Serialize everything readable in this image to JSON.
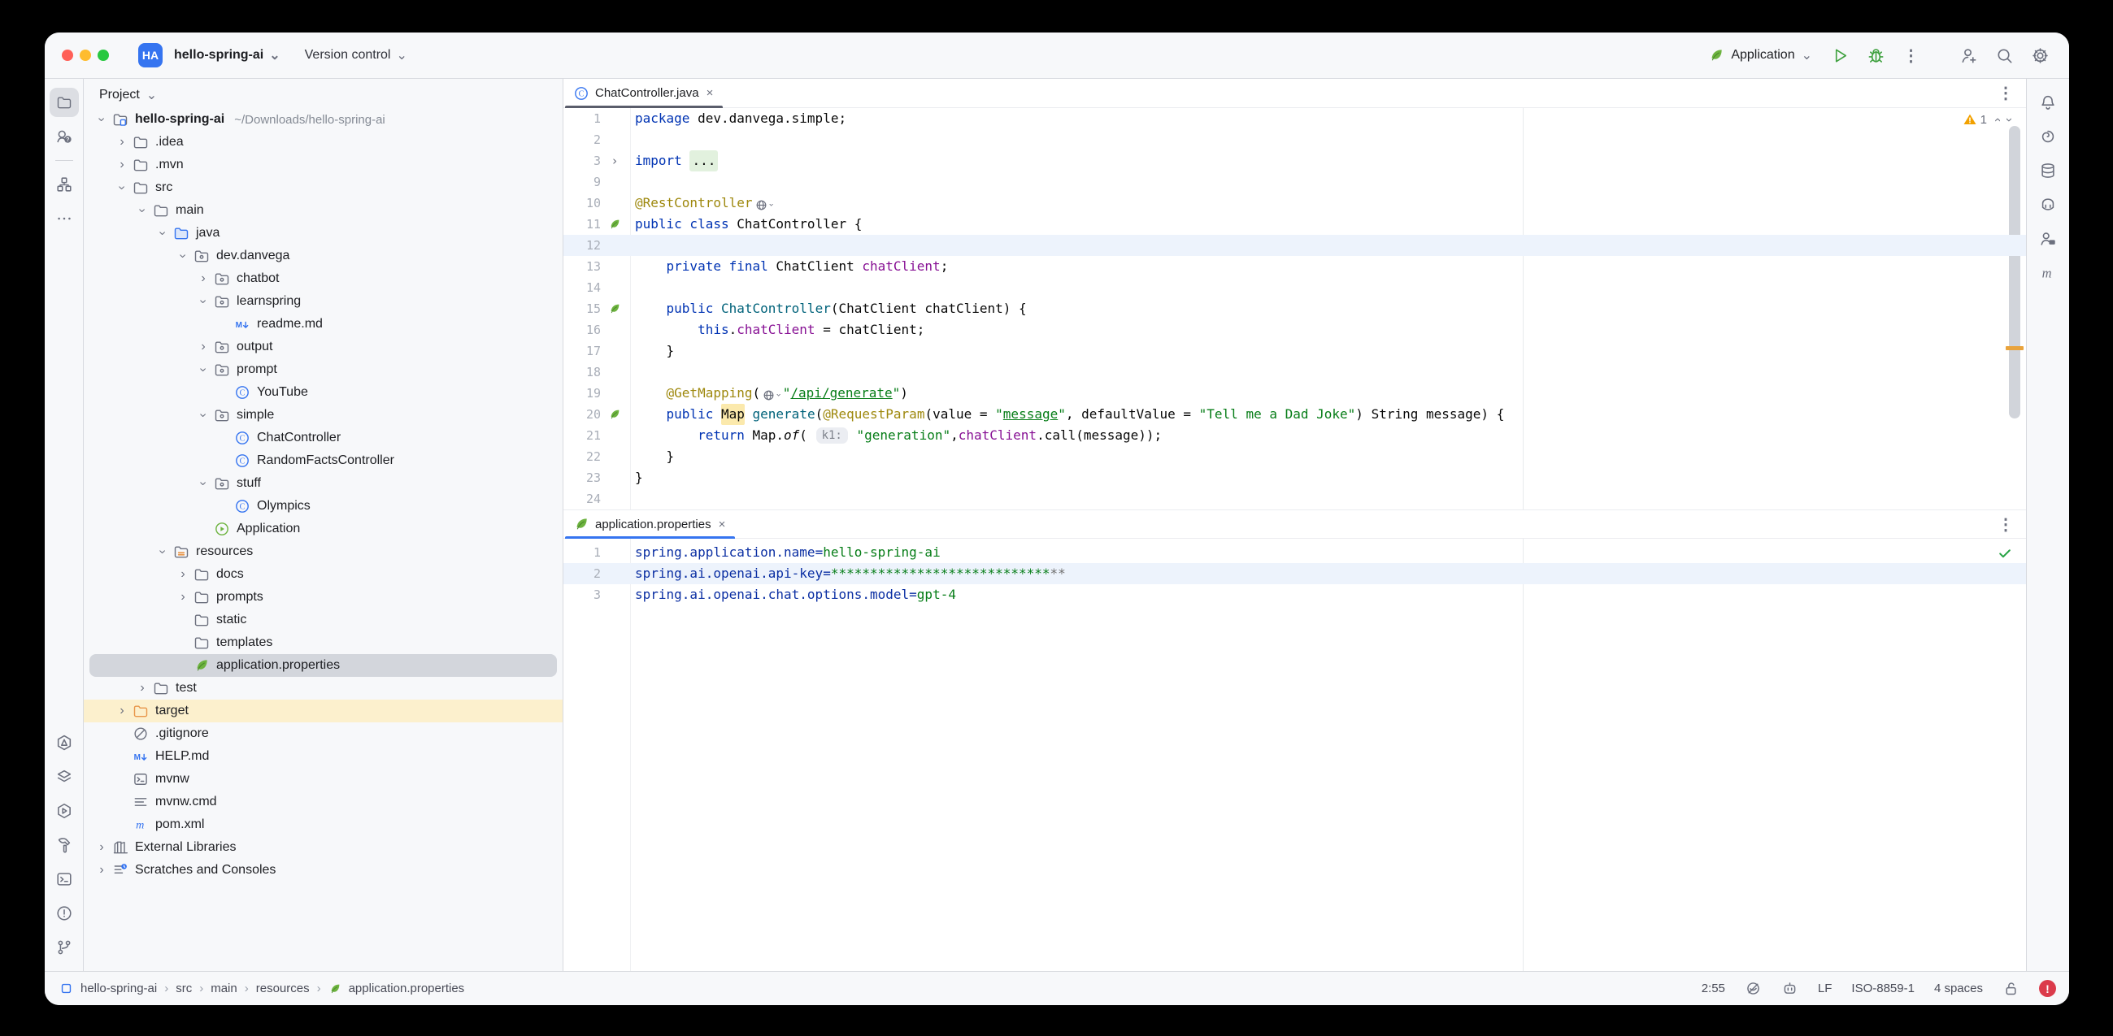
{
  "colors": {
    "accent": "#3574F0",
    "spring_green": "#6DB33F",
    "run_green": "#3FA13F",
    "warn": "#F2A100",
    "error_badge": "#DB3B4B",
    "selection": "#d3d6dc",
    "excluded_row": "#fcf0cd",
    "caret_row": "#edf3fc"
  },
  "titlebar": {
    "app_badge": "HA",
    "project_button": "hello-spring-ai",
    "version_control_button": "Version control",
    "run_config": "Application"
  },
  "left_strip": {
    "top": [
      {
        "icon": "folder",
        "name": "project-tool-icon",
        "active": true
      },
      {
        "icon": "people-question",
        "name": "pull-requests-icon"
      },
      {
        "icon": "divider"
      },
      {
        "icon": "structure",
        "name": "structure-tool-icon"
      },
      {
        "icon": "more",
        "name": "more-tool-windows-icon"
      }
    ],
    "bottom": [
      {
        "icon": "endpoints",
        "name": "endpoints-icon"
      },
      {
        "icon": "layers",
        "name": "layers-icon"
      },
      {
        "icon": "services",
        "name": "services-icon"
      },
      {
        "icon": "hammer",
        "name": "build-icon"
      },
      {
        "icon": "terminal",
        "name": "terminal-icon"
      },
      {
        "icon": "problems",
        "name": "problems-icon"
      },
      {
        "icon": "branch",
        "name": "git-branch-icon"
      }
    ]
  },
  "right_strip": [
    {
      "icon": "bell",
      "name": "notifications-bell-icon"
    },
    {
      "icon": "ai",
      "name": "ai-assistant-icon"
    },
    {
      "icon": "db",
      "name": "database-icon"
    },
    {
      "icon": "copilot",
      "name": "copilot-icon"
    },
    {
      "icon": "cwm",
      "name": "code-with-me-icon"
    },
    {
      "icon": "maven-m",
      "name": "maven-tool-icon"
    }
  ],
  "project_panel": {
    "header": "Project",
    "rows": [
      {
        "label": "hello-spring-ai",
        "level": 0,
        "chev": "v",
        "icon": "folder-project",
        "bold": true,
        "extra": "~/Downloads/hello-spring-ai"
      },
      {
        "label": ".idea",
        "level": 1,
        "chev": ">",
        "icon": "folder"
      },
      {
        "label": ".mvn",
        "level": 1,
        "chev": ">",
        "icon": "folder"
      },
      {
        "label": "src",
        "level": 1,
        "chev": "v",
        "icon": "folder"
      },
      {
        "label": "main",
        "level": 2,
        "chev": "v",
        "icon": "folder"
      },
      {
        "label": "java",
        "level": 3,
        "chev": "v",
        "icon": "folder-java"
      },
      {
        "label": "dev.danvega",
        "level": 4,
        "chev": "v",
        "icon": "package"
      },
      {
        "label": "chatbot",
        "level": 5,
        "chev": ">",
        "icon": "package"
      },
      {
        "label": "learnspring",
        "level": 5,
        "chev": "v",
        "icon": "package"
      },
      {
        "label": "readme.md",
        "level": 6,
        "chev": "",
        "icon": "md"
      },
      {
        "label": "output",
        "level": 5,
        "chev": ">",
        "icon": "package"
      },
      {
        "label": "prompt",
        "level": 5,
        "chev": "v",
        "icon": "package"
      },
      {
        "label": "YouTube",
        "level": 6,
        "chev": "",
        "icon": "class"
      },
      {
        "label": "simple",
        "level": 5,
        "chev": "v",
        "icon": "package"
      },
      {
        "label": "ChatController",
        "level": 6,
        "chev": "",
        "icon": "class"
      },
      {
        "label": "RandomFactsController",
        "level": 6,
        "chev": "",
        "icon": "class"
      },
      {
        "label": "stuff",
        "level": 5,
        "chev": "v",
        "icon": "package"
      },
      {
        "label": "Olympics",
        "level": 6,
        "chev": "",
        "icon": "class"
      },
      {
        "label": "Application",
        "level": 5,
        "chev": "",
        "icon": "bootapp"
      },
      {
        "label": "resources",
        "level": 3,
        "chev": "v",
        "icon": "folder-res"
      },
      {
        "label": "docs",
        "level": 4,
        "chev": ">",
        "icon": "folder"
      },
      {
        "label": "prompts",
        "level": 4,
        "chev": ">",
        "icon": "folder"
      },
      {
        "label": "static",
        "level": 4,
        "chev": "",
        "icon": "folder"
      },
      {
        "label": "templates",
        "level": 4,
        "chev": "",
        "icon": "folder"
      },
      {
        "label": "application.properties",
        "level": 4,
        "chev": "",
        "icon": "leaf",
        "sel": true
      },
      {
        "label": "test",
        "level": 2,
        "chev": ">",
        "icon": "folder"
      },
      {
        "label": "target",
        "level": 1,
        "chev": ">",
        "icon": "folder-orange",
        "hi": true
      },
      {
        "label": ".gitignore",
        "level": 1,
        "chev": "",
        "icon": "ignore"
      },
      {
        "label": "HELP.md",
        "level": 1,
        "chev": "",
        "icon": "md"
      },
      {
        "label": "mvnw",
        "level": 1,
        "chev": "",
        "icon": "term"
      },
      {
        "label": "mvnw.cmd",
        "level": 1,
        "chev": "",
        "icon": "lines"
      },
      {
        "label": "pom.xml",
        "level": 1,
        "chev": "",
        "icon": "maven"
      },
      {
        "label": "External Libraries",
        "level": 0,
        "chev": ">",
        "icon": "library"
      },
      {
        "label": "Scratches and Consoles",
        "level": 0,
        "chev": ">",
        "icon": "scratch"
      }
    ]
  },
  "editor_top": {
    "tab": "ChatController.java",
    "tab_icon": "class",
    "inspection_warning_count": "1",
    "lines": [
      {
        "num": "1",
        "segs": [
          {
            "t": "package ",
            "c": "kw"
          },
          {
            "t": "dev.danvega.simple;",
            "c": "pln"
          }
        ]
      },
      {
        "num": "2",
        "segs": []
      },
      {
        "num": "3",
        "fold": true,
        "segs": [
          {
            "t": "import ",
            "c": "kw"
          },
          {
            "t": "...",
            "c": "pln fold"
          }
        ]
      },
      {
        "num": "9",
        "segs": []
      },
      {
        "num": "10",
        "segs": [
          {
            "t": "@RestController",
            "c": "ann"
          },
          {
            "icon": "globe-chev"
          }
        ]
      },
      {
        "num": "11",
        "gicon": "leaf",
        "segs": [
          {
            "t": "public class ",
            "c": "kw"
          },
          {
            "t": "ChatController {",
            "c": "pln"
          }
        ]
      },
      {
        "num": "12",
        "caret": true,
        "segs": []
      },
      {
        "num": "13",
        "segs": [
          {
            "t": "    ",
            "c": "pln"
          },
          {
            "t": "private final ",
            "c": "kw"
          },
          {
            "t": "ChatClient ",
            "c": "pln"
          },
          {
            "t": "chatClient",
            "c": "fld"
          },
          {
            "t": ";",
            "c": "pln"
          }
        ]
      },
      {
        "num": "14",
        "segs": []
      },
      {
        "num": "15",
        "gicon": "leaf",
        "segs": [
          {
            "t": "    ",
            "c": "pln"
          },
          {
            "t": "public ",
            "c": "kw"
          },
          {
            "t": "ChatController",
            "c": "mth"
          },
          {
            "t": "(ChatClient chatClient) {",
            "c": "pln"
          }
        ]
      },
      {
        "num": "16",
        "segs": [
          {
            "t": "        ",
            "c": "pln"
          },
          {
            "t": "this",
            "c": "kw"
          },
          {
            "t": ".",
            "c": "pln"
          },
          {
            "t": "chatClient",
            "c": "fld"
          },
          {
            "t": " = chatClient;",
            "c": "pln"
          }
        ]
      },
      {
        "num": "17",
        "segs": [
          {
            "t": "    }",
            "c": "pln"
          }
        ]
      },
      {
        "num": "18",
        "segs": []
      },
      {
        "num": "19",
        "segs": [
          {
            "t": "    ",
            "c": "pln"
          },
          {
            "t": "@GetMapping",
            "c": "ann"
          },
          {
            "t": "(",
            "c": "pln"
          },
          {
            "icon": "globe-chev"
          },
          {
            "t": "\"",
            "c": "str"
          },
          {
            "t": "/api/generate",
            "c": "strU"
          },
          {
            "t": "\"",
            "c": "str"
          },
          {
            "t": ")",
            "c": "pln"
          }
        ]
      },
      {
        "num": "20",
        "gicon": "leaf-globe",
        "segs": [
          {
            "t": "    ",
            "c": "pln"
          },
          {
            "t": "public ",
            "c": "kw"
          },
          {
            "t": "Map",
            "c": "pln hl"
          },
          {
            "t": " ",
            "c": "pln"
          },
          {
            "t": "generate",
            "c": "mth"
          },
          {
            "t": "(",
            "c": "pln"
          },
          {
            "t": "@RequestParam",
            "c": "ann"
          },
          {
            "t": "(value = ",
            "c": "pln"
          },
          {
            "t": "\"",
            "c": "str"
          },
          {
            "t": "message",
            "c": "strU"
          },
          {
            "t": "\"",
            "c": "str"
          },
          {
            "t": ", defaultValue = ",
            "c": "pln"
          },
          {
            "t": "\"Tell me a Dad Joke\"",
            "c": "str"
          },
          {
            "t": ") String message) {",
            "c": "pln"
          }
        ]
      },
      {
        "num": "21",
        "segs": [
          {
            "t": "        ",
            "c": "pln"
          },
          {
            "t": "return ",
            "c": "kw"
          },
          {
            "t": "Map.",
            "c": "pln"
          },
          {
            "t": "of",
            "c": "pln it"
          },
          {
            "t": "( ",
            "c": "pln"
          },
          {
            "t": "k1:",
            "c": "inlay"
          },
          {
            "t": " ",
            "c": "pln"
          },
          {
            "t": "\"generation\"",
            "c": "str"
          },
          {
            "t": ",",
            "c": "pln"
          },
          {
            "t": "chatClient",
            "c": "fld"
          },
          {
            "t": ".call(message));",
            "c": "pln"
          }
        ]
      },
      {
        "num": "22",
        "segs": [
          {
            "t": "    }",
            "c": "pln"
          }
        ]
      },
      {
        "num": "23",
        "segs": [
          {
            "t": "}",
            "c": "pln"
          }
        ]
      },
      {
        "num": "24",
        "segs": []
      }
    ]
  },
  "editor_bottom": {
    "tab": "application.properties",
    "tab_icon": "leaf",
    "lines": [
      {
        "num": "1",
        "segs": [
          {
            "t": "spring.application.name",
            "c": "pkey"
          },
          {
            "t": "=",
            "c": "pkey"
          },
          {
            "t": "hello-spring-ai",
            "c": "str"
          }
        ]
      },
      {
        "num": "2",
        "caret": true,
        "segs": [
          {
            "t": "spring.ai.openai.api-key",
            "c": "pkey"
          },
          {
            "t": "=",
            "c": "pkey"
          },
          {
            "t": "****************************",
            "c": "str"
          },
          {
            "t": "**",
            "c": "gray"
          }
        ]
      },
      {
        "num": "3",
        "segs": [
          {
            "t": "spring.ai.openai.chat.options.model",
            "c": "pkey"
          },
          {
            "t": "=",
            "c": "pkey"
          },
          {
            "t": "gpt-4",
            "c": "str"
          }
        ]
      }
    ]
  },
  "status_bar": {
    "breadcrumbs": [
      "hello-spring-ai",
      "src",
      "main",
      "resources",
      "application.properties"
    ],
    "caret_position": "2:55",
    "line_ending": "LF",
    "encoding": "ISO-8859-1",
    "indent": "4 spaces"
  }
}
